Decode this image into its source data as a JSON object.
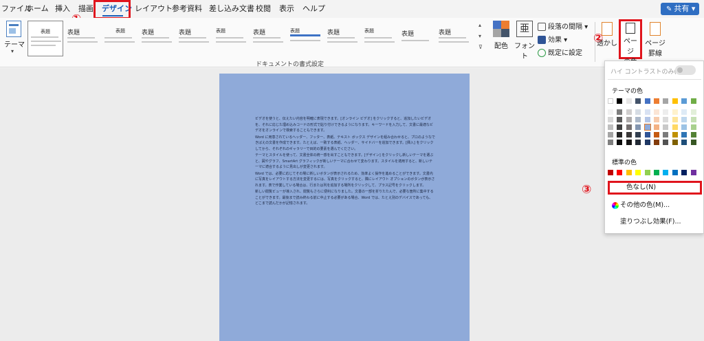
{
  "tabs": [
    "ファイル",
    "ホーム",
    "挿入",
    "描画",
    "デザイン",
    "レイアウト",
    "参考資料",
    "差し込み文書",
    "校閲",
    "表示",
    "ヘルプ"
  ],
  "active_tab": "デザイン",
  "share": {
    "label": "共有",
    "icon": "pencil-icon"
  },
  "ribbon": {
    "theme_label": "テーマ",
    "gallery_label": "ドキュメントの書式設定",
    "style_titles": [
      "表題",
      "表題",
      "表題",
      "表題",
      "表題",
      "表題",
      "表題",
      "表題",
      "表題",
      "表題",
      "表題",
      "表題",
      "表題"
    ],
    "colors_label": "配色",
    "fonts_label": "フォント",
    "paragraph_spacing_label": "段落の間隔",
    "effects_label": "効果",
    "set_default_label": "既定に設定",
    "watermark_label": "透かし",
    "page_color_label_1": "ページ",
    "page_color_label_2": "の色",
    "page_border_label_1": "ページ",
    "page_border_label_2": "罫線"
  },
  "callouts": {
    "one": "①",
    "two": "②",
    "three": "③"
  },
  "document": {
    "paragraphs": [
      "ビデオを使うと、伝えたい内容を明確に表現できます。[オンライン ビデオ] をクリックすると、追加したいビデオを、それに応じた埋め込みコードの形式で貼り付けできるようになります。キーワードを入力して、文書に最適なビデオをオンラインで検索することもできます。",
      "Word に用意されているヘッダー、フッター、表紙、テキスト ボックス デザインを組み合わせると、プロのようなできばえの文書を作成できます。たとえば、一致する表紙、ヘッダー、サイドバーを追加できます。[挿入] をクリックしてから、それぞれのギャラリーで目的の要素を選んでください。",
      "テーマとスタイルを使って、文書全体の統一感を出すこともできます。[デザイン] をクリックし新しいテーマを選ぶと、図やグラフ、SmartArt グラフィックが新しいテーマに合わせて変わります。スタイルを適用すると、新しいテーマに適合するように見出しが変更されます。",
      "Word では、必要に応じてその場に新しいボタンが表示されるため、効率よく操作を進めることができます。文書内に写真をレイアウトする方法を変更するには、写真をクリックすると、隣にレイアウト オプションのボタンが表示されます。表で作業している場合は、行または列を追加する場所をクリックして、プラス記号をクリックします。",
      "新しい閲覧ビューが導入され、閲覧もさらに便利になりました。文書の一部を折りたたんで、必要な箇所に集中することができます。最後まで読み終わる前に中止する必要がある場合、Word では、たとえ別のデバイスであっても、どこまで読んだかが記憶されます。"
    ]
  },
  "dropdown": {
    "high_contrast_label": "ハイ コントラストのみ(H)",
    "theme_colors_label": "テーマの色",
    "standard_colors_label": "標準の色",
    "no_color_label": "色なし(N)",
    "more_colors_label": "その他の色(M)...",
    "fill_effects_label": "塗りつぶし効果(F)...",
    "theme_top": [
      "#ffffff",
      "#000000",
      "#e7e6e6",
      "#44546a",
      "#4472c4",
      "#ed7d31",
      "#a5a5a5",
      "#ffc000",
      "#5b9bd5",
      "#70ad47"
    ],
    "theme_shades": [
      [
        "#f2f2f2",
        "#7f7f7f",
        "#d0cece",
        "#d6dce4",
        "#d9e2f3",
        "#fbe5d5",
        "#ededed",
        "#fff2cc",
        "#deebf6",
        "#e2efd9"
      ],
      [
        "#d8d8d8",
        "#595959",
        "#aeabab",
        "#adb9ca",
        "#b4c6e7",
        "#f7cbac",
        "#dbdbdb",
        "#fee599",
        "#bdd7ee",
        "#c5e0b3"
      ],
      [
        "#bfbfbf",
        "#3f3f3f",
        "#757070",
        "#8496b0",
        "#8eaadb",
        "#f4b183",
        "#c9c9c9",
        "#ffd965",
        "#9cc3e5",
        "#a8d08d"
      ],
      [
        "#a5a5a5",
        "#262626",
        "#3a3838",
        "#323f4f",
        "#2f5496",
        "#c55a11",
        "#7b7b7b",
        "#bf9000",
        "#2e75b5",
        "#538135"
      ],
      [
        "#7f7f7f",
        "#0c0c0c",
        "#171616",
        "#222a35",
        "#1f3864",
        "#833c0b",
        "#525252",
        "#7f6000",
        "#1e4e79",
        "#375623"
      ]
    ],
    "standard": [
      "#c00000",
      "#ff0000",
      "#ffc000",
      "#ffff00",
      "#92d050",
      "#00b050",
      "#00b0f0",
      "#0070c0",
      "#002060",
      "#7030a0"
    ]
  }
}
